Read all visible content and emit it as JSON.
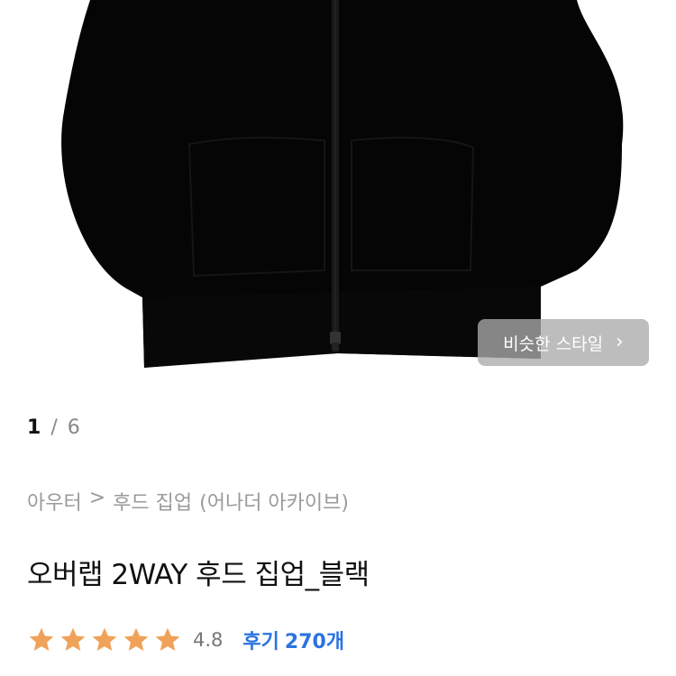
{
  "gallery": {
    "current_index": "1",
    "separator": "/",
    "total": "6",
    "similar_style_label": "비슷한 스타일",
    "similar_style_icon": "chevron-right-icon"
  },
  "breadcrumb": {
    "category": "아우터",
    "separator": ">",
    "subcategory": "후드 집업",
    "brand": "(어나더 아카이브)"
  },
  "product": {
    "title": "오버랩 2WAY 후드 집업_블랙",
    "color": "#000000"
  },
  "rating": {
    "stars": 5,
    "star_color": "#f0a25a",
    "value": "4.8",
    "reviews_label": "후기",
    "reviews_count": "270개",
    "reviews_color": "#2b73e0"
  }
}
